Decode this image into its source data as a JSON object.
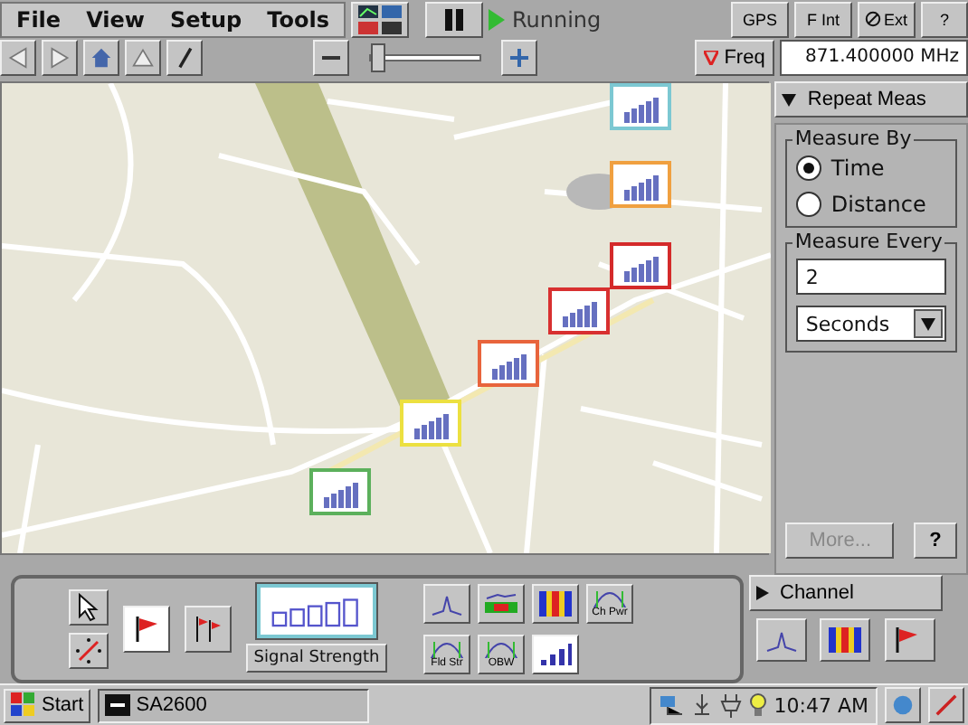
{
  "menu": [
    "File",
    "View",
    "Setup",
    "Tools"
  ],
  "run": {
    "paused": false,
    "status": "Running"
  },
  "zoom": {
    "level": 0.05
  },
  "top_buttons": [
    {
      "kind": "gps",
      "label": "GPS"
    },
    {
      "kind": "fint",
      "label": "F Int"
    },
    {
      "kind": "ext",
      "label": "Ext"
    },
    {
      "kind": "help",
      "label": "?"
    }
  ],
  "freq": {
    "label": "Freq",
    "value": "871.400000 MHz"
  },
  "map": {
    "markers": [
      {
        "color": "#7cc8d2"
      },
      {
        "color": "#f0a040"
      },
      {
        "color": "#d42a2a"
      },
      {
        "color": "#d83030"
      },
      {
        "color": "#e8643c"
      },
      {
        "color": "#ece040"
      },
      {
        "color": "#5cb05c"
      }
    ]
  },
  "panel": {
    "title": "Repeat Meas",
    "expanded": true,
    "measure_by": {
      "label": "Measure By",
      "options": [
        {
          "label": "Time",
          "selected": true
        },
        {
          "label": "Distance",
          "selected": false
        }
      ]
    },
    "measure_every": {
      "label": "Measure Every",
      "value": "2",
      "unit": "Seconds"
    },
    "more": {
      "label": "More...",
      "disabled": true
    },
    "help": "?"
  },
  "channel": {
    "title": "Channel",
    "expanded": false
  },
  "tools": [
    {
      "kind": "pointer",
      "selected": false
    },
    {
      "kind": "markers",
      "selected": false
    },
    {
      "kind": "flag",
      "selected": true
    },
    {
      "kind": "flags",
      "selected": false
    }
  ],
  "signal_strength": {
    "label": "Signal Strength",
    "selected": true
  },
  "measurements": [
    {
      "kind": "spectrum",
      "selected": false
    },
    {
      "kind": "spectrogram-strip",
      "selected": false
    },
    {
      "kind": "spectrogram",
      "selected": false
    },
    {
      "kind": "curve",
      "label": "Ch Pwr",
      "selected": false
    },
    {
      "kind": "curve",
      "label": "Fld Str",
      "selected": false
    },
    {
      "kind": "curve",
      "label": "OBW",
      "selected": false
    },
    {
      "kind": "bars",
      "selected": true
    }
  ],
  "side_tools": [
    {
      "kind": "spectrum"
    },
    {
      "kind": "spectrogram"
    },
    {
      "kind": "flag"
    }
  ],
  "taskbar": {
    "start": "Start",
    "task": "SA2600",
    "clock": "10:47 AM"
  }
}
